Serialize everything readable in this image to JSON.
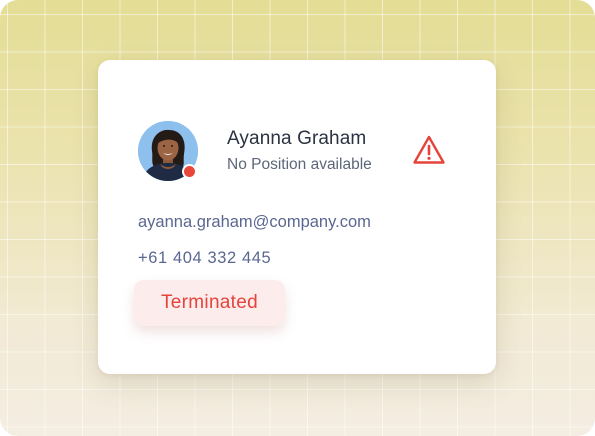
{
  "contact": {
    "name": "Ayanna Graham",
    "position": "No Position available",
    "email": "ayanna.graham@company.com",
    "phone": "+61 404 332 445",
    "status": "Terminated",
    "presence": "offline"
  },
  "icons": {
    "warning": "warning-triangle-icon"
  },
  "colors": {
    "status_text": "#e5433b",
    "status_background": "#fdecec",
    "warning": "#e5433b",
    "presence_dot": "#e8463a",
    "backdrop_top": "#e3dd95",
    "backdrop_bottom": "#f4ede2"
  }
}
